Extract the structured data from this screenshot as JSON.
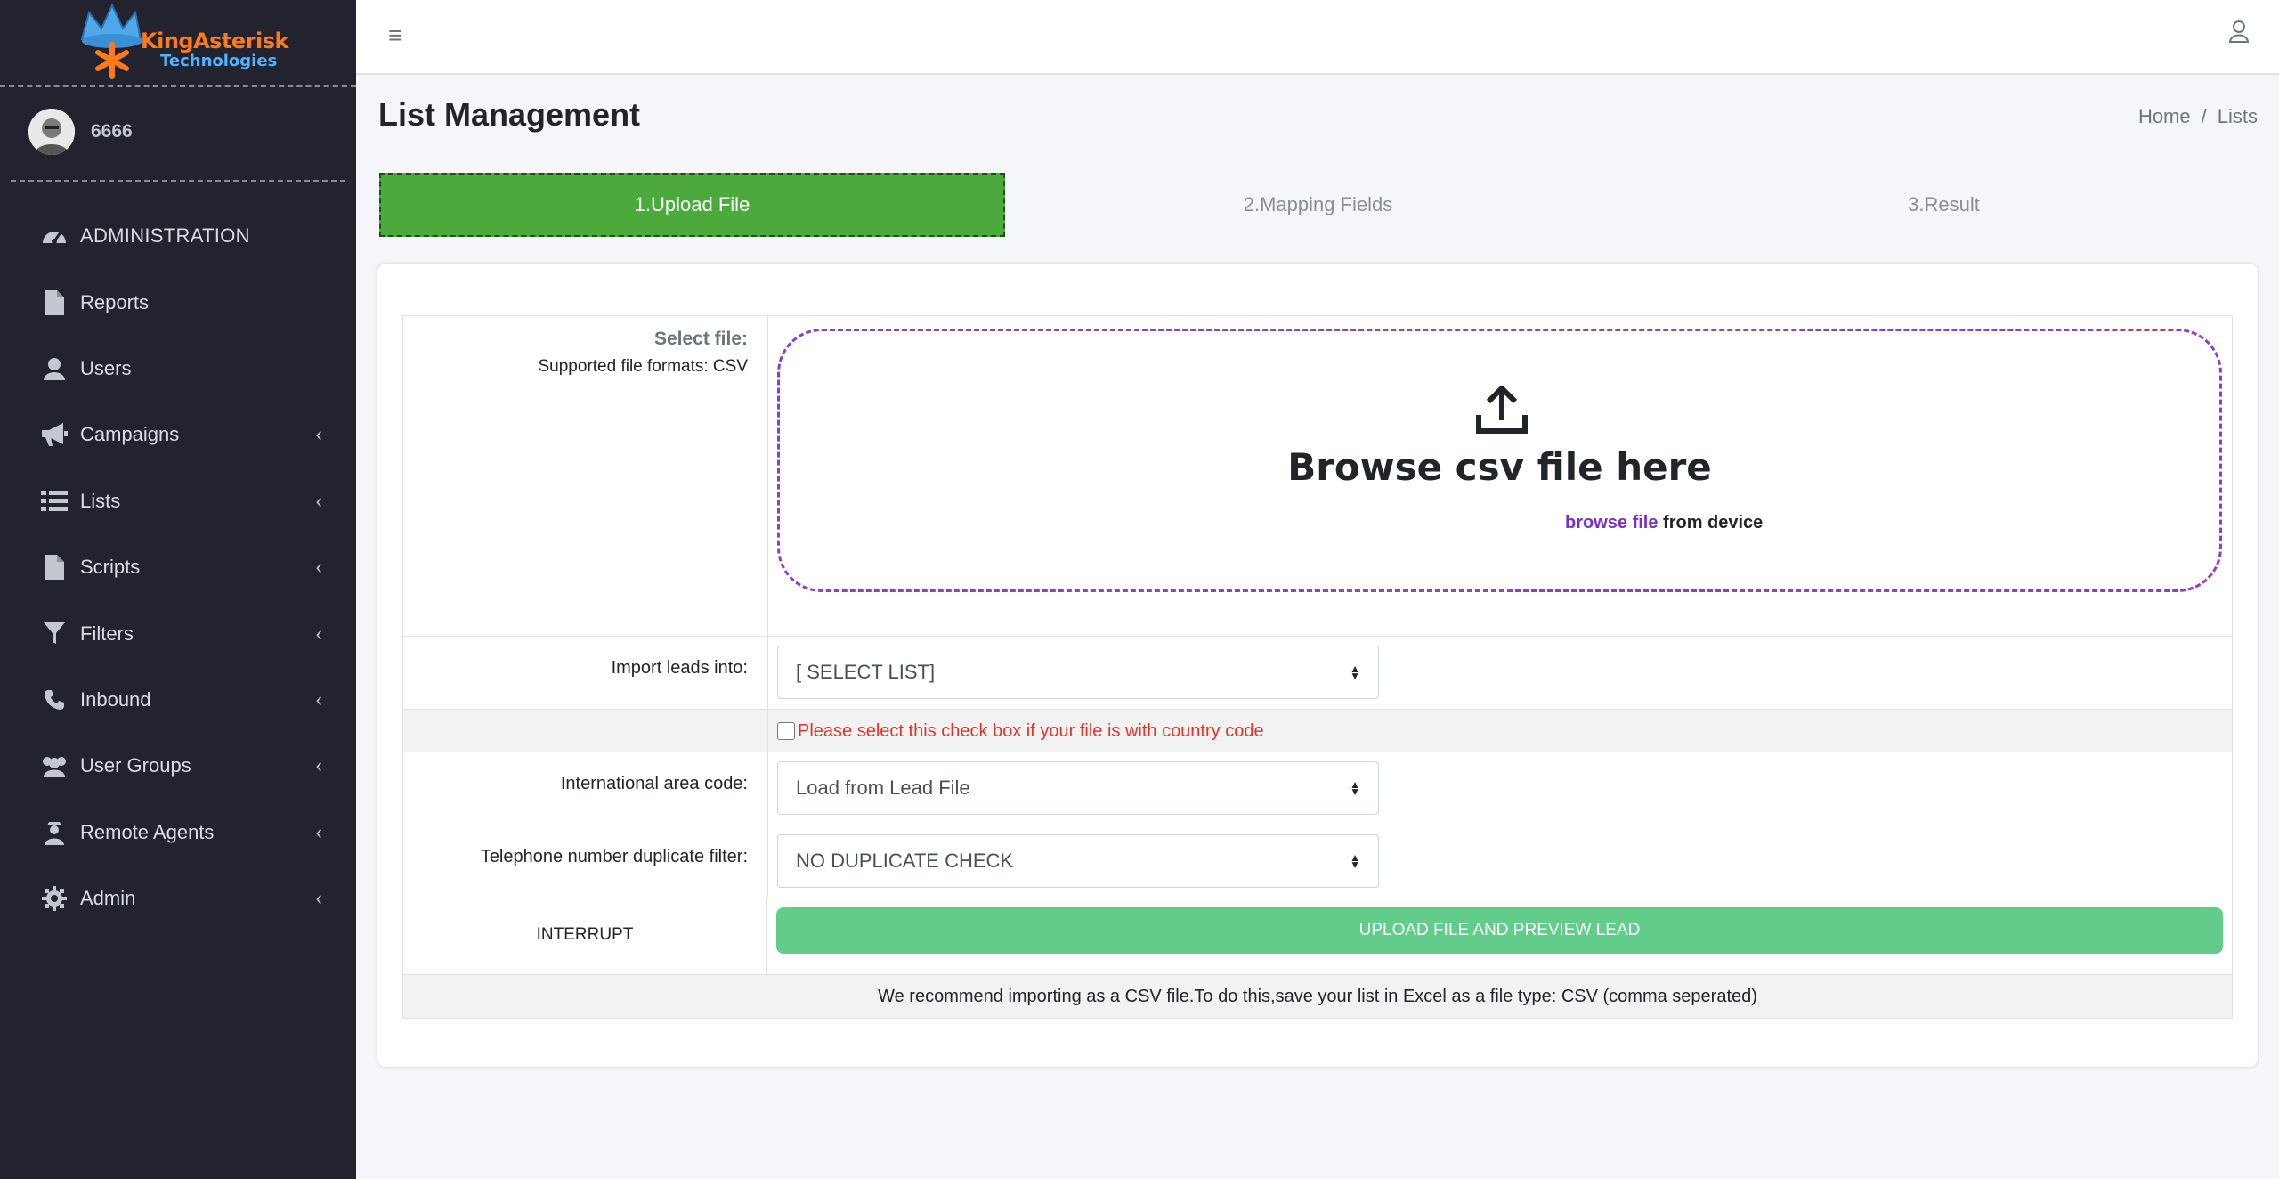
{
  "brand": {
    "line1": "KingAsterisk",
    "line2": "Technologies"
  },
  "user": {
    "name": "6666"
  },
  "nav": [
    {
      "label": "ADMINISTRATION",
      "icon": "dashboard-icon",
      "chevron": false
    },
    {
      "label": "Reports",
      "icon": "file-icon",
      "chevron": false
    },
    {
      "label": "Users",
      "icon": "user-icon",
      "chevron": false
    },
    {
      "label": "Campaigns",
      "icon": "megaphone-icon",
      "chevron": true
    },
    {
      "label": "Lists",
      "icon": "list-icon",
      "chevron": true
    },
    {
      "label": "Scripts",
      "icon": "file-icon",
      "chevron": true
    },
    {
      "label": "Filters",
      "icon": "filter-icon",
      "chevron": true
    },
    {
      "label": "Inbound",
      "icon": "phone-icon",
      "chevron": true
    },
    {
      "label": "User Groups",
      "icon": "users-icon",
      "chevron": true
    },
    {
      "label": "Remote Agents",
      "icon": "agent-icon",
      "chevron": true
    },
    {
      "label": "Admin",
      "icon": "gear-icon",
      "chevron": true
    }
  ],
  "page": {
    "title": "List Management"
  },
  "breadcrumb": {
    "home": "Home",
    "sep": "/",
    "current": "Lists"
  },
  "steps": [
    "1.Upload File",
    "2.Mapping Fields",
    "3.Result"
  ],
  "form": {
    "select_file_label": "Select file:",
    "supported_formats": "Supported file formats: CSV",
    "dropzone_title": "Browse csv file here",
    "dropzone_link": "browse file",
    "dropzone_suffix": " from device",
    "import_label": "Import leads into:",
    "import_value": "[ SELECT LIST]",
    "checkbox_text": "Please select this check box if your file is with country code",
    "area_code_label": "International area code:",
    "area_code_value": "Load from Lead File",
    "dup_label": "Telephone number duplicate filter:",
    "dup_value": "NO DUPLICATE CHECK",
    "interrupt_label": "INTERRUPT",
    "upload_button": "UPLOAD FILE AND PREVIEW LEAD",
    "note": "We recommend importing as a CSV file.To do this,save your list in Excel as a file type: CSV (comma seperated)"
  },
  "colors": {
    "sidebar": "#23232f",
    "step_active": "#4caa3c",
    "upload_button": "#62cd8a",
    "dropzone_border": "#8a3fd1",
    "warning_text": "#e0342a"
  }
}
